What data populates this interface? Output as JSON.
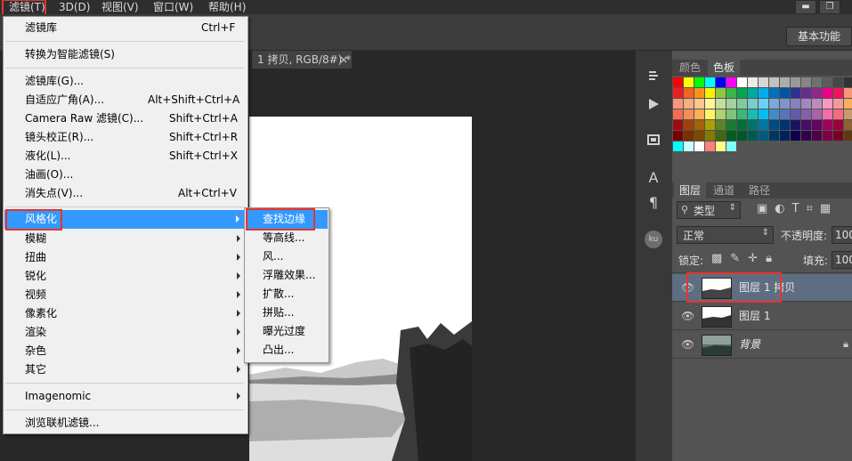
{
  "menubar": {
    "items": [
      "滤镜(T)",
      "3D(D)",
      "视图(V)",
      "窗口(W)",
      "帮助(H)"
    ],
    "window_controls": [
      "minimize",
      "restore"
    ]
  },
  "workspace_button": "基本功能",
  "document_tab": {
    "label": "1 拷贝, RGB/8#) *",
    "close": "×"
  },
  "filter_menu": {
    "items": [
      {
        "label": "滤镜库",
        "shortcut": "Ctrl+F"
      },
      {
        "label": "转换为智能滤镜(S)",
        "shortcut": ""
      },
      {
        "label": "滤镜库(G)...",
        "shortcut": ""
      },
      {
        "label": "自适应广角(A)...",
        "shortcut": "Alt+Shift+Ctrl+A"
      },
      {
        "label": "Camera Raw 滤镜(C)...",
        "shortcut": "Shift+Ctrl+A"
      },
      {
        "label": "镜头校正(R)...",
        "shortcut": "Shift+Ctrl+R"
      },
      {
        "label": "液化(L)...",
        "shortcut": "Shift+Ctrl+X"
      },
      {
        "label": "油画(O)...",
        "shortcut": ""
      },
      {
        "label": "消失点(V)...",
        "shortcut": "Alt+Ctrl+V"
      },
      {
        "label": "风格化",
        "shortcut": ""
      },
      {
        "label": "模糊",
        "shortcut": ""
      },
      {
        "label": "扭曲",
        "shortcut": ""
      },
      {
        "label": "锐化",
        "shortcut": ""
      },
      {
        "label": "视频",
        "shortcut": ""
      },
      {
        "label": "像素化",
        "shortcut": ""
      },
      {
        "label": "渲染",
        "shortcut": ""
      },
      {
        "label": "杂色",
        "shortcut": ""
      },
      {
        "label": "其它",
        "shortcut": ""
      },
      {
        "label": "Imagenomic",
        "shortcut": ""
      },
      {
        "label": "浏览联机滤镜...",
        "shortcut": ""
      }
    ]
  },
  "stylize_submenu": {
    "items": [
      "查找边缘",
      "等高线...",
      "风...",
      "浮雕效果...",
      "扩散...",
      "拼贴...",
      "曝光过度",
      "凸出..."
    ]
  },
  "swatch_panel": {
    "tabs": [
      "颜色",
      "色板"
    ],
    "colors": [
      "#ff0000",
      "#ffff00",
      "#00ff00",
      "#00ffff",
      "#0000ff",
      "#ff00ff",
      "#ffffff",
      "#ebebeb",
      "#d6d6d6",
      "#c2c2c2",
      "#adadad",
      "#999999",
      "#858585",
      "#707070",
      "#5c5c5c",
      "#474747",
      "#333333",
      "#000000",
      "#ed1c24",
      "#f26522",
      "#f7941d",
      "#fff200",
      "#8dc63f",
      "#39b54a",
      "#00a651",
      "#00a99d",
      "#00aeef",
      "#0072bc",
      "#0054a6",
      "#2e3192",
      "#662d91",
      "#92278f",
      "#ec008c",
      "#ed145b",
      "#f69679",
      "#fdc689",
      "#f7977a",
      "#fbad82",
      "#fdc68c",
      "#fff79a",
      "#c4df9b",
      "#a3d39c",
      "#82ca9c",
      "#7accc8",
      "#6dcff6",
      "#7da7d8",
      "#8393ca",
      "#8781bd",
      "#a187be",
      "#bd8cbf",
      "#f49ac1",
      "#f6989d",
      "#fbaf5d",
      "#fff568",
      "#f26c4f",
      "#f68e56",
      "#fbaf5c",
      "#fff467",
      "#acd373",
      "#7cc576",
      "#3bb878",
      "#1abbb4",
      "#00bff3",
      "#438cca",
      "#5574b9",
      "#605ca8",
      "#855fa8",
      "#a763a8",
      "#f06eaa",
      "#f26d7d",
      "#c69c6d",
      "#a67c52",
      "#9e0b0f",
      "#a0410d",
      "#a3620a",
      "#aba000",
      "#598527",
      "#1a7b30",
      "#007236",
      "#00746b",
      "#0076a3",
      "#004b80",
      "#003471",
      "#1b1464",
      "#440e62",
      "#630460",
      "#9e005d",
      "#9e0039",
      "#8c6239",
      "#754c24",
      "#790000",
      "#7b2e00",
      "#7d4900",
      "#827b00",
      "#406618",
      "#005e20",
      "#005826",
      "#005952",
      "#005b7f",
      "#003663",
      "#002157",
      "#0d004c",
      "#32004b",
      "#4b0049",
      "#7b0046",
      "#7a0026",
      "#603913",
      "#3c2415",
      "#00ffff",
      "#ccffff",
      "#ffffff",
      "#ff8080",
      "#ffff80",
      "#80ffff"
    ]
  },
  "layers_panel": {
    "tabs": [
      "图层",
      "通道",
      "路径"
    ],
    "filter_kind": "类型",
    "blend_mode": "正常",
    "opacity_label": "不透明度:",
    "opacity_value": "100",
    "lock_label": "锁定:",
    "fill_label": "填充:",
    "fill_value": "100",
    "layers": [
      {
        "name": "图层 1 拷贝",
        "selected": true
      },
      {
        "name": "图层 1",
        "selected": false
      },
      {
        "name": "背景",
        "selected": false
      }
    ]
  },
  "icon_strip": [
    "history-icon",
    "actions-icon",
    "properties-icon",
    "character-icon",
    "paragraph-icon",
    "plugin-ku-icon"
  ],
  "strip_glyphs": {
    "character": "A",
    "paragraph": "¶",
    "ku": "ku"
  },
  "colors": {
    "highlight": "#3399ff",
    "annotation_red": "#e8332a",
    "selected_layer": "#5f6d82"
  }
}
